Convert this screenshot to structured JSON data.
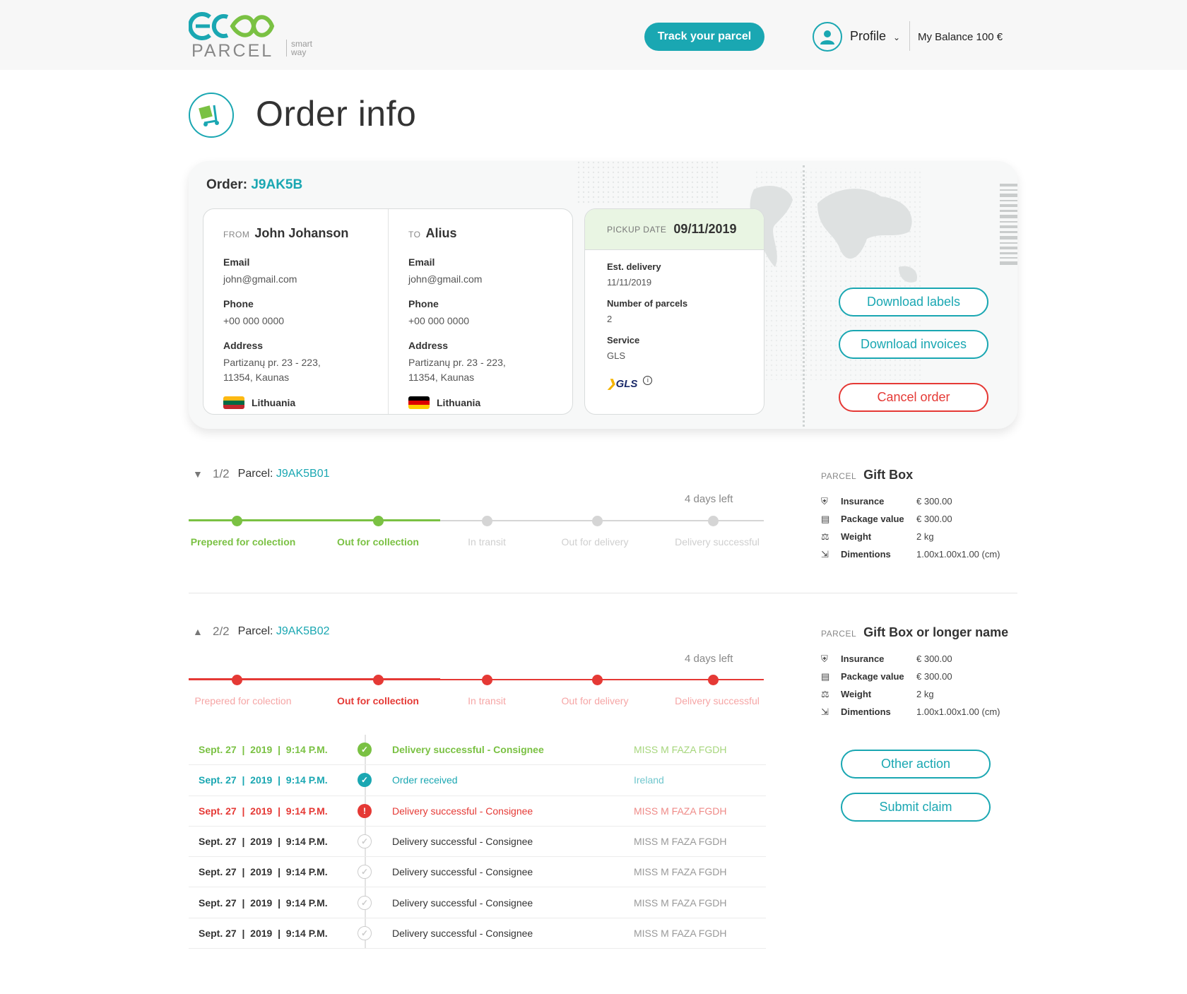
{
  "header": {
    "logo_word": "PARCEL",
    "logo_tag_1": "smart",
    "logo_tag_2": "way",
    "track_button": "Track your parcel",
    "profile_label": "Profile",
    "balance": "My Balance 100 €"
  },
  "page": {
    "title": "Order info"
  },
  "order": {
    "label": "Order:",
    "id": "J9AK5B",
    "from": {
      "prefix": "FROM",
      "name": "John Johanson",
      "email_label": "Email",
      "email": "john@gmail.com",
      "phone_label": "Phone",
      "phone": "+00 000 0000",
      "address_label": "Address",
      "address_1": "Partizanų pr. 23 - 223,",
      "address_2": "11354, Kaunas",
      "country": "Lithuania"
    },
    "to": {
      "prefix": "TO",
      "name": "Alius",
      "email_label": "Email",
      "email": "john@gmail.com",
      "phone_label": "Phone",
      "phone": "+00 000 0000",
      "address_label": "Address",
      "address_1": "Partizanų pr. 23 - 223,",
      "address_2": "11354, Kaunas",
      "country": "Lithuania"
    },
    "pickup": {
      "prefix": "PICKUP DATE",
      "date": "09/11/2019",
      "est_label": "Est. delivery",
      "est_value": "11/11/2019",
      "parcels_label": "Number of parcels",
      "parcels_value": "2",
      "service_label": "Service",
      "service_value": "GLS",
      "carrier_logo": "GLS"
    },
    "buttons": {
      "download_labels": "Download labels",
      "download_invoices": "Download invoices",
      "cancel": "Cancel order"
    }
  },
  "parcels": [
    {
      "index": "1/2",
      "label": "Parcel:",
      "id": "J9AK5B01",
      "days_left": "4 days left",
      "steps": [
        "Prepered for colection",
        "Out for collection",
        "In transit",
        "Out for delivery",
        "Delivery successful"
      ],
      "side": {
        "prefix": "PARCEL",
        "name": "Gift Box",
        "rows": [
          {
            "k": "Insurance",
            "v": "€ 300.00"
          },
          {
            "k": "Package value",
            "v": "€ 300.00"
          },
          {
            "k": "Weight",
            "v": "2 kg"
          },
          {
            "k": "Dimentions",
            "v": "1.00x1.00x1.00 (cm)"
          }
        ]
      }
    },
    {
      "index": "2/2",
      "label": "Parcel:",
      "id": "J9AK5B02",
      "days_left": "4 days left",
      "steps": [
        "Prepered for colection",
        "Out for collection",
        "In transit",
        "Out for delivery",
        "Delivery successful"
      ],
      "side": {
        "prefix": "PARCEL",
        "name": "Gift Box or longer name",
        "rows": [
          {
            "k": "Insurance",
            "v": "€ 300.00"
          },
          {
            "k": "Package value",
            "v": "€ 300.00"
          },
          {
            "k": "Weight",
            "v": "2 kg"
          },
          {
            "k": "Dimentions",
            "v": "1.00x1.00x1.00 (cm)"
          }
        ]
      },
      "buttons": {
        "other": "Other action",
        "claim": "Submit claim"
      }
    }
  ],
  "history": [
    {
      "date": "Sept. 27  |  2019  |  9:14 P.M.",
      "text": "Delivery successful - Consignee",
      "who": "MISS M FAZA FGDH"
    },
    {
      "date": "Sept. 27  |  2019  |  9:14 P.M.",
      "text": "Order received",
      "who": "Ireland"
    },
    {
      "date": "Sept. 27  |  2019  |  9:14 P.M.",
      "text": "Delivery successful - Consignee",
      "who": "MISS M FAZA FGDH"
    },
    {
      "date": "Sept. 27  |  2019  |  9:14 P.M.",
      "text": "Delivery successful - Consignee",
      "who": "MISS M FAZA FGDH"
    },
    {
      "date": "Sept. 27  |  2019  |  9:14 P.M.",
      "text": "Delivery successful - Consignee",
      "who": "MISS M FAZA FGDH"
    },
    {
      "date": "Sept. 27  |  2019  |  9:14 P.M.",
      "text": "Delivery successful - Consignee",
      "who": "MISS M FAZA FGDH"
    },
    {
      "date": "Sept. 27  |  2019  |  9:14 P.M.",
      "text": "Delivery successful - Consignee",
      "who": "MISS M FAZA FGDH"
    }
  ],
  "colors": {
    "accent": "#1aa7b2",
    "green": "#7ac143",
    "red": "#e53935",
    "red_light": "#f6a5a5",
    "grey": "#cccccc"
  }
}
